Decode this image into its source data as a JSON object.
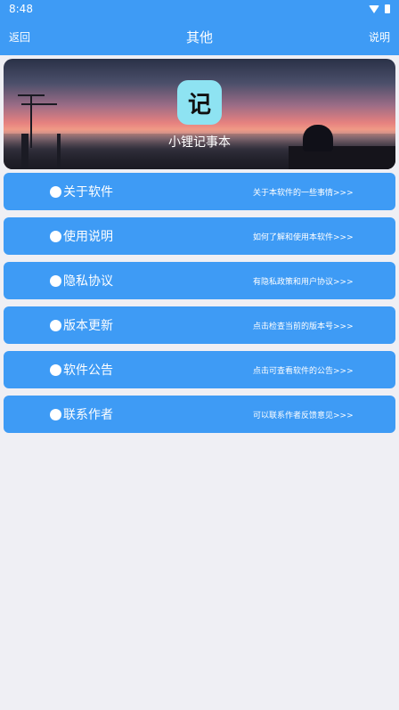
{
  "status": {
    "time": "8:48"
  },
  "header": {
    "back": "返回",
    "title": "其他",
    "help": "说明"
  },
  "banner": {
    "icon_char": "记",
    "app_name": "小锂记事本"
  },
  "menu": [
    {
      "label": "关于软件",
      "desc": "关于本软件的一些事情>>>"
    },
    {
      "label": "使用说明",
      "desc": "如何了解和使用本软件>>>"
    },
    {
      "label": "隐私协议",
      "desc": "有隐私政策和用户协议>>>"
    },
    {
      "label": "版本更新",
      "desc": "点击检查当前的版本号>>>"
    },
    {
      "label": "软件公告",
      "desc": "点击可查看软件的公告>>>"
    },
    {
      "label": "联系作者",
      "desc": "可以联系作者反馈意见>>>"
    }
  ],
  "colors": {
    "accent": "#3E9BF5",
    "background": "#EFEFF4",
    "icon_bg": "#8EE3F2"
  }
}
